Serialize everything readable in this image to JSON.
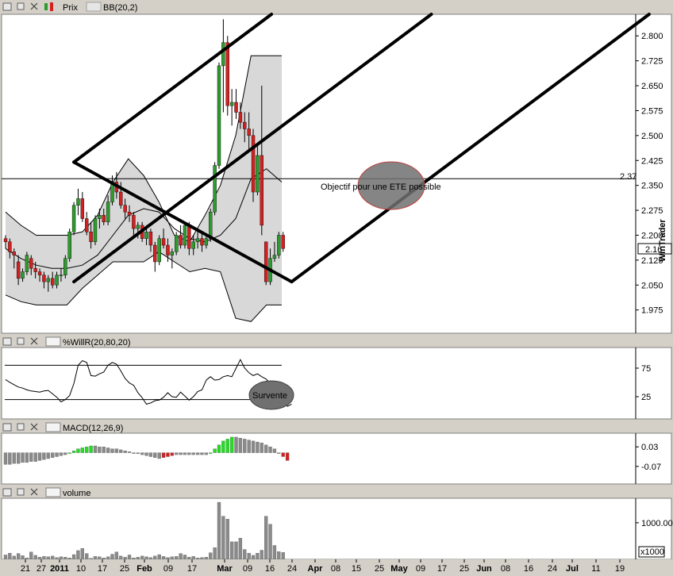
{
  "panels": {
    "price": {
      "title": "Prix",
      "indicator": "BB(20,2)",
      "last_value": "2.16"
    },
    "willr": {
      "title": "%WillR(20,80,20)"
    },
    "macd": {
      "title": "MACD(12,26,9)"
    },
    "volume": {
      "title": "volume",
      "unit": "x1000"
    }
  },
  "annotations": {
    "objective": "Objectif pour une ETE possible",
    "oversold": "Survente",
    "hline_label": "2.37"
  },
  "watermark": "WinTrader",
  "colors": {
    "up": "#2e9b2e",
    "down": "#d42020",
    "macd_up": "#22dd22",
    "band_fill": "#d8d8d8",
    "ellipse": "#707070"
  },
  "chart_data": [
    {
      "type": "candlestick",
      "title": "Prix",
      "ylim": [
        1.905,
        2.865
      ],
      "y_ticks": [
        "2.800",
        "2.725",
        "2.650",
        "2.575",
        "2.500",
        "2.425",
        "2.350",
        "2.275",
        "2.200",
        "2.125",
        "2.050",
        "1.975"
      ],
      "x_ticks": [
        "21",
        "27",
        "2011",
        "10",
        "17",
        "25",
        "Feb",
        "09",
        "17",
        "Mar",
        "09",
        "16",
        "24",
        "Apr",
        "08",
        "15",
        "25",
        "May",
        "09",
        "17",
        "25",
        "Jun",
        "08",
        "16",
        "24",
        "Jul",
        "11",
        "19"
      ],
      "horizontal_line": 2.37,
      "candles": [
        {
          "o": 2.19,
          "h": 2.2,
          "l": 2.16,
          "c": 2.18
        },
        {
          "o": 2.18,
          "h": 2.19,
          "l": 2.13,
          "c": 2.15
        },
        {
          "o": 2.15,
          "h": 2.16,
          "l": 2.1,
          "c": 2.14
        },
        {
          "o": 2.12,
          "h": 2.14,
          "l": 2.05,
          "c": 2.07
        },
        {
          "o": 2.07,
          "h": 2.1,
          "l": 2.06,
          "c": 2.09
        },
        {
          "o": 2.09,
          "h": 2.15,
          "l": 2.08,
          "c": 2.14
        },
        {
          "o": 2.13,
          "h": 2.14,
          "l": 2.08,
          "c": 2.1
        },
        {
          "o": 2.1,
          "h": 2.12,
          "l": 2.07,
          "c": 2.09
        },
        {
          "o": 2.09,
          "h": 2.1,
          "l": 2.06,
          "c": 2.08
        },
        {
          "o": 2.08,
          "h": 2.09,
          "l": 2.04,
          "c": 2.06
        },
        {
          "o": 2.06,
          "h": 2.08,
          "l": 2.03,
          "c": 2.07
        },
        {
          "o": 2.07,
          "h": 2.09,
          "l": 2.04,
          "c": 2.05
        },
        {
          "o": 2.05,
          "h": 2.09,
          "l": 2.04,
          "c": 2.08
        },
        {
          "o": 2.08,
          "h": 2.1,
          "l": 2.06,
          "c": 2.08
        },
        {
          "o": 2.08,
          "h": 2.14,
          "l": 2.07,
          "c": 2.13
        },
        {
          "o": 2.13,
          "h": 2.22,
          "l": 2.12,
          "c": 2.21
        },
        {
          "o": 2.21,
          "h": 2.3,
          "l": 2.2,
          "c": 2.29
        },
        {
          "o": 2.29,
          "h": 2.34,
          "l": 2.26,
          "c": 2.31
        },
        {
          "o": 2.31,
          "h": 2.33,
          "l": 2.24,
          "c": 2.25
        },
        {
          "o": 2.25,
          "h": 2.27,
          "l": 2.2,
          "c": 2.21
        },
        {
          "o": 2.21,
          "h": 2.24,
          "l": 2.16,
          "c": 2.18
        },
        {
          "o": 2.18,
          "h": 2.26,
          "l": 2.17,
          "c": 2.25
        },
        {
          "o": 2.25,
          "h": 2.28,
          "l": 2.22,
          "c": 2.26
        },
        {
          "o": 2.26,
          "h": 2.28,
          "l": 2.23,
          "c": 2.24
        },
        {
          "o": 2.24,
          "h": 2.32,
          "l": 2.23,
          "c": 2.3
        },
        {
          "o": 2.3,
          "h": 2.38,
          "l": 2.29,
          "c": 2.36
        },
        {
          "o": 2.36,
          "h": 2.39,
          "l": 2.31,
          "c": 2.33
        },
        {
          "o": 2.33,
          "h": 2.36,
          "l": 2.28,
          "c": 2.29
        },
        {
          "o": 2.29,
          "h": 2.31,
          "l": 2.25,
          "c": 2.27
        },
        {
          "o": 2.27,
          "h": 2.29,
          "l": 2.24,
          "c": 2.26
        },
        {
          "o": 2.26,
          "h": 2.27,
          "l": 2.2,
          "c": 2.22
        },
        {
          "o": 2.22,
          "h": 2.24,
          "l": 2.19,
          "c": 2.23
        },
        {
          "o": 2.23,
          "h": 2.24,
          "l": 2.18,
          "c": 2.19
        },
        {
          "o": 2.19,
          "h": 2.23,
          "l": 2.17,
          "c": 2.21
        },
        {
          "o": 2.21,
          "h": 2.22,
          "l": 2.15,
          "c": 2.17
        },
        {
          "o": 2.17,
          "h": 2.18,
          "l": 2.09,
          "c": 2.12
        },
        {
          "o": 2.12,
          "h": 2.2,
          "l": 2.11,
          "c": 2.19
        },
        {
          "o": 2.19,
          "h": 2.22,
          "l": 2.16,
          "c": 2.17
        },
        {
          "o": 2.17,
          "h": 2.19,
          "l": 2.12,
          "c": 2.14
        },
        {
          "o": 2.14,
          "h": 2.16,
          "l": 2.1,
          "c": 2.15
        },
        {
          "o": 2.15,
          "h": 2.21,
          "l": 2.14,
          "c": 2.2
        },
        {
          "o": 2.2,
          "h": 2.23,
          "l": 2.16,
          "c": 2.17
        },
        {
          "o": 2.17,
          "h": 2.24,
          "l": 2.16,
          "c": 2.23
        },
        {
          "o": 2.23,
          "h": 2.24,
          "l": 2.14,
          "c": 2.16
        },
        {
          "o": 2.16,
          "h": 2.2,
          "l": 2.14,
          "c": 2.18
        },
        {
          "o": 2.18,
          "h": 2.22,
          "l": 2.16,
          "c": 2.19
        },
        {
          "o": 2.19,
          "h": 2.21,
          "l": 2.15,
          "c": 2.17
        },
        {
          "o": 2.17,
          "h": 2.2,
          "l": 2.16,
          "c": 2.19
        },
        {
          "o": 2.19,
          "h": 2.28,
          "l": 2.18,
          "c": 2.27
        },
        {
          "o": 2.27,
          "h": 2.42,
          "l": 2.26,
          "c": 2.41
        },
        {
          "o": 2.41,
          "h": 2.72,
          "l": 2.4,
          "c": 2.71
        },
        {
          "o": 2.71,
          "h": 2.85,
          "l": 2.57,
          "c": 2.78
        },
        {
          "o": 2.78,
          "h": 2.8,
          "l": 2.56,
          "c": 2.59
        },
        {
          "o": 2.59,
          "h": 2.64,
          "l": 2.53,
          "c": 2.6
        },
        {
          "o": 2.6,
          "h": 2.64,
          "l": 2.55,
          "c": 2.57
        },
        {
          "o": 2.57,
          "h": 2.6,
          "l": 2.52,
          "c": 2.54
        },
        {
          "o": 2.54,
          "h": 2.57,
          "l": 2.48,
          "c": 2.52
        },
        {
          "o": 2.52,
          "h": 2.57,
          "l": 2.45,
          "c": 2.5
        },
        {
          "o": 2.5,
          "h": 2.52,
          "l": 2.3,
          "c": 2.33
        },
        {
          "o": 2.33,
          "h": 2.47,
          "l": 2.32,
          "c": 2.44
        },
        {
          "o": 2.44,
          "h": 2.65,
          "l": 2.2,
          "c": 2.23
        },
        {
          "o": 2.18,
          "h": 2.18,
          "l": 2.05,
          "c": 2.06
        },
        {
          "o": 2.06,
          "h": 2.16,
          "l": 2.05,
          "c": 2.13
        },
        {
          "o": 2.13,
          "h": 2.18,
          "l": 2.12,
          "c": 2.14
        },
        {
          "o": 2.14,
          "h": 2.21,
          "l": 2.13,
          "c": 2.2
        },
        {
          "o": 2.2,
          "h": 2.21,
          "l": 2.15,
          "c": 2.16
        }
      ],
      "bollinger": {
        "upper": [
          2.27,
          2.23,
          2.2,
          2.2,
          2.2,
          2.21,
          2.26,
          2.36,
          2.43,
          2.38,
          2.3,
          2.2,
          2.18,
          2.26,
          2.35,
          2.5,
          2.74,
          2.74,
          2.74
        ],
        "middle": [
          2.16,
          2.13,
          2.11,
          2.1,
          2.1,
          2.11,
          2.14,
          2.2,
          2.26,
          2.28,
          2.27,
          2.22,
          2.19,
          2.18,
          2.2,
          2.25,
          2.37,
          2.4,
          2.36
        ],
        "lower": [
          2.02,
          2.0,
          1.99,
          1.99,
          1.99,
          2.04,
          2.08,
          2.12,
          2.12,
          2.12,
          2.15,
          2.12,
          2.09,
          2.1,
          2.09,
          1.95,
          1.94,
          1.99,
          1.99
        ]
      },
      "trendlines": [
        {
          "from": [
            16,
            2.42
          ],
          "to": [
            null,
            2.865
          ]
        },
        {
          "from": [
            16,
            2.42
          ],
          "to": [
            67,
            2.06
          ]
        },
        {
          "from": [
            16,
            2.06
          ],
          "to": [
            null,
            2.865
          ]
        },
        {
          "from": [
            67,
            2.06
          ],
          "to": [
            null,
            2.865
          ]
        }
      ]
    },
    {
      "type": "line",
      "title": "%WillR(20,80,20)",
      "ylim": [
        0,
        100
      ],
      "y_ticks": [
        "75",
        "25"
      ],
      "levels": [
        80,
        20
      ],
      "values": [
        55,
        50,
        46,
        42,
        40,
        37,
        35,
        34,
        33,
        35,
        36,
        30,
        24,
        16,
        20,
        27,
        48,
        80,
        88,
        85,
        62,
        61,
        65,
        68,
        80,
        85,
        82,
        70,
        57,
        49,
        45,
        32,
        23,
        12,
        14,
        18,
        19,
        24,
        32,
        25,
        24,
        33,
        26,
        19,
        25,
        34,
        37,
        54,
        60,
        54,
        55,
        60,
        62,
        60,
        75,
        90,
        75,
        67,
        62,
        65,
        60,
        56,
        48,
        44,
        42,
        25,
        8,
        12
      ]
    },
    {
      "type": "bar",
      "title": "MACD(12,26,9)",
      "ylim": [
        -0.16,
        0.1
      ],
      "y_ticks": [
        "0.03",
        "-0.07"
      ],
      "values": [
        -0.06,
        -0.06,
        -0.055,
        -0.055,
        -0.05,
        -0.05,
        -0.045,
        -0.045,
        -0.04,
        -0.035,
        -0.03,
        -0.025,
        -0.02,
        -0.015,
        -0.01,
        0.0,
        0.01,
        0.02,
        0.025,
        0.03,
        0.035,
        0.035,
        0.03,
        0.03,
        0.025,
        0.02,
        0.02,
        0.015,
        0.01,
        0.005,
        0.0,
        -0.005,
        -0.01,
        -0.015,
        -0.02,
        -0.025,
        -0.03,
        -0.025,
        -0.02,
        -0.015,
        -0.01,
        -0.01,
        -0.01,
        -0.01,
        -0.01,
        -0.01,
        -0.01,
        -0.01,
        0.0,
        0.02,
        0.04,
        0.06,
        0.07,
        0.08,
        0.08,
        0.075,
        0.07,
        0.065,
        0.06,
        0.055,
        0.05,
        0.04,
        0.03,
        0.02,
        0.0,
        -0.02,
        -0.04
      ]
    },
    {
      "type": "bar",
      "title": "volume",
      "unit": "x1000",
      "ylim": [
        0,
        1670
      ],
      "y_ticks": [
        "1000.00"
      ],
      "values": [
        120,
        170,
        90,
        160,
        100,
        40,
        200,
        110,
        60,
        80,
        70,
        90,
        50,
        70,
        60,
        40,
        130,
        240,
        300,
        160,
        30,
        80,
        70,
        40,
        70,
        140,
        200,
        90,
        60,
        120,
        40,
        60,
        90,
        70,
        50,
        90,
        130,
        80,
        50,
        70,
        80,
        160,
        120,
        60,
        80,
        40,
        50,
        60,
        180,
        320,
        1560,
        1180,
        1100,
        480,
        480,
        580,
        270,
        170,
        110,
        170,
        250,
        1180,
        960,
        380,
        210,
        190
      ]
    }
  ]
}
